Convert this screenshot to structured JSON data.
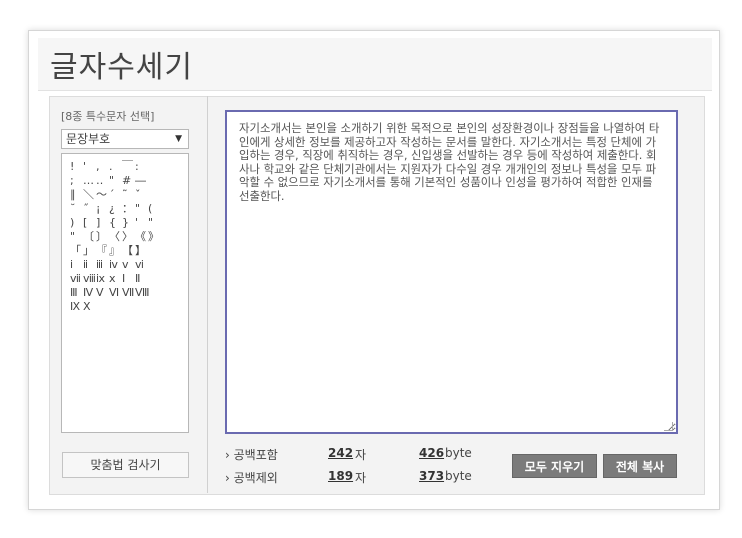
{
  "app": {
    "title": "글자수세기"
  },
  "sidebar": {
    "group_label": "[8종 특수문자 선택]",
    "select_value": "문장부호",
    "select_arrow": "▼",
    "char_rows": [
      [
        "!",
        "'",
        ",",
        ".",
        "￣",
        ":"
      ],
      [
        ";",
        "…",
        "‥",
        "\"",
        "#",
        "―"
      ],
      [
        "∥",
        "＼",
        "～",
        "´",
        "˜",
        "ˇ"
      ],
      [
        "˘",
        "˝",
        "¡",
        "¿",
        "：",
        "\"",
        "("
      ],
      [
        ")",
        "[",
        "]",
        "{",
        "}",
        "'",
        "\""
      ],
      [
        "\"",
        "〔",
        "〕",
        "〈",
        "〉",
        "《",
        "》"
      ],
      [
        "「",
        "」",
        "『",
        "』",
        "【",
        "】"
      ],
      [
        "ⅰ",
        "ⅱ",
        "ⅲ",
        "ⅳ",
        "ⅴ",
        "ⅵ"
      ],
      [
        "ⅶ",
        "ⅷ",
        "ⅸ",
        "ⅹ",
        "Ⅰ",
        "Ⅱ"
      ],
      [
        "Ⅲ",
        "Ⅳ",
        "Ⅴ",
        "Ⅵ",
        "Ⅶ",
        "Ⅷ"
      ],
      [
        "Ⅸ",
        "Ⅹ"
      ]
    ],
    "spell_check_label": "맞춤법 검사기"
  },
  "editor": {
    "text": "자기소개서는 본인을 소개하기 위한 목적으로 본인의 성장환경이나 장점들을 나열하여 타인에게 상세한 정보를 제공하고자 작성하는 문서를 말한다. 자기소개서는 특정 단체에 가입하는 경우, 직장에 취직하는 경우, 신입생을 선발하는 경우 등에 작성하여 제출한다. 회사나 학교와 같은 단체기관에서는 지원자가 다수일 경우 개개인의 정보나 특성을 모두 파악할 수 없으므로 자기소개서를 통해 기본적인 성품이나 인성을 평가하여 적합한 인재를 선출한다."
  },
  "stats": {
    "with_space": {
      "label": "› 공백포함",
      "chars": "242",
      "chars_unit": "자",
      "bytes": "426",
      "bytes_unit": "byte"
    },
    "without_space": {
      "label": "› 공백제외",
      "chars": "189",
      "chars_unit": "자",
      "bytes": "373",
      "bytes_unit": "byte"
    }
  },
  "actions": {
    "clear_all": "모두 지우기",
    "copy_all": "전체 복사"
  }
}
